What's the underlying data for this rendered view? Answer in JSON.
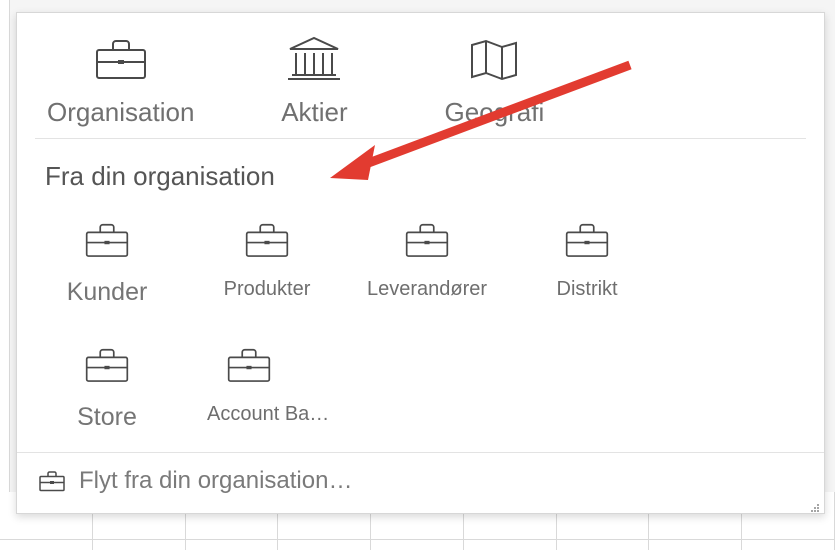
{
  "top_row": [
    {
      "key": "organisation",
      "icon": "briefcase",
      "label": "Organisation"
    },
    {
      "key": "aktier",
      "icon": "institution",
      "label": "Aktier"
    },
    {
      "key": "geografi",
      "icon": "map",
      "label": "Geografi"
    }
  ],
  "section_title": "Fra din organisation",
  "org_items": [
    {
      "key": "kunder",
      "icon": "briefcase",
      "label": "Kunder"
    },
    {
      "key": "produkter",
      "icon": "briefcase",
      "label": "Produkter"
    },
    {
      "key": "leverandorer",
      "icon": "briefcase",
      "label": "Leverandører"
    },
    {
      "key": "distrikt",
      "icon": "briefcase",
      "label": "Distrikt"
    },
    {
      "key": "store",
      "icon": "briefcase",
      "label": "Store"
    },
    {
      "key": "accountba",
      "icon": "briefcase",
      "label": "Account Ba…"
    }
  ],
  "footer": {
    "icon": "briefcase",
    "text": "Flyt fra din organisation…"
  },
  "annotation_arrow": {
    "color": "#e23b30"
  }
}
